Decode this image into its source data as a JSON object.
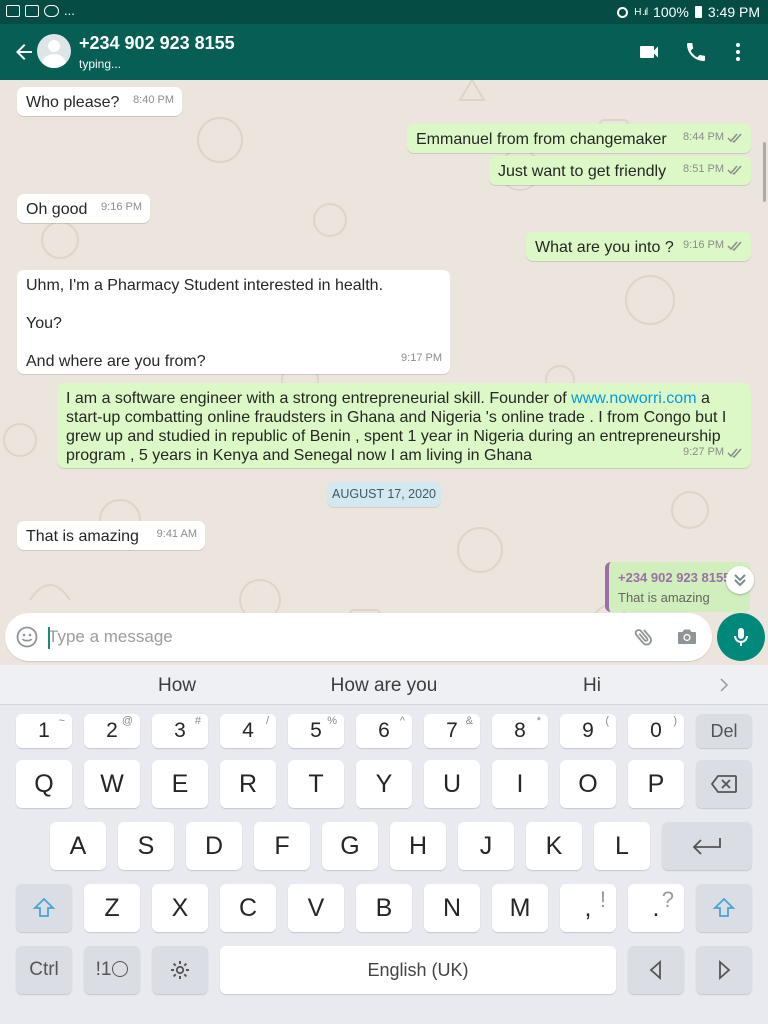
{
  "status_bar": {
    "battery": "100%",
    "time": "3:49 PM",
    "more": "..."
  },
  "header": {
    "contact": "+234 902 923 8155",
    "status": "typing..."
  },
  "messages": [
    {
      "text": "Who please?",
      "time": "8:40 PM",
      "dir": "in"
    },
    {
      "text": "Emmanuel from from changemaker",
      "time": "8:44 PM",
      "dir": "out"
    },
    {
      "text": "Just want to get friendly",
      "time": "8:51 PM",
      "dir": "out"
    },
    {
      "text": "Oh good",
      "time": "9:16 PM",
      "dir": "in"
    },
    {
      "text": "What are you into ?",
      "time": "9:16 PM",
      "dir": "out"
    },
    {
      "lines": [
        "Uhm, I'm a Pharmacy Student interested in health.",
        "You?",
        "And where are you from?"
      ],
      "time": "9:17 PM",
      "dir": "in"
    },
    {
      "parts": [
        "I am a software engineer with a strong entrepreneurial skill. Founder of ",
        "www.noworri.com",
        " a start-up combatting online fraudsters in Ghana and Nigeria 's online trade . I  from Congo but I grew up and studied in republic of Benin , spent 1 year in Nigeria during an entrepreneurship program , 5 years in Kenya and Senegal now I am living in Ghana"
      ],
      "time": "9:27 PM",
      "dir": "out"
    },
    {
      "text": "That is amazing",
      "time": "9:41 AM",
      "dir": "in"
    }
  ],
  "date_chip": "AUGUST 17, 2020",
  "reply_preview": {
    "sender": "+234 902 923 8155",
    "text": "That is amazing"
  },
  "composer": {
    "placeholder": "Type a message"
  },
  "keyboard": {
    "suggestions": [
      "How",
      "How are you",
      "Hi"
    ],
    "number_row": [
      {
        "k": "1",
        "s": "~"
      },
      {
        "k": "2",
        "s": "@"
      },
      {
        "k": "3",
        "s": "#"
      },
      {
        "k": "4",
        "s": "/"
      },
      {
        "k": "5",
        "s": "%"
      },
      {
        "k": "6",
        "s": "^"
      },
      {
        "k": "7",
        "s": "&"
      },
      {
        "k": "8",
        "s": "*"
      },
      {
        "k": "9",
        "s": "("
      },
      {
        "k": "0",
        "s": ")"
      }
    ],
    "del": "Del",
    "row1": [
      "Q",
      "W",
      "E",
      "R",
      "T",
      "Y",
      "U",
      "I",
      "O",
      "P"
    ],
    "row2": [
      "A",
      "S",
      "D",
      "F",
      "G",
      "H",
      "J",
      "K",
      "L"
    ],
    "row3": [
      "Z",
      "X",
      "C",
      "V",
      "B",
      "N",
      "M"
    ],
    "comma": {
      "k": ",",
      "s": "!"
    },
    "period": {
      "k": ".",
      "s": "?"
    },
    "ctrl": "Ctrl",
    "symbols": "!1",
    "space": "English (UK)"
  },
  "colors": {
    "header": "#075e54",
    "status_bar": "#054d44",
    "outgoing": "#dcf8c6",
    "incoming": "#ffffff",
    "accent": "#00897b",
    "link": "#039be5",
    "ticks": "#8c8c8c"
  }
}
